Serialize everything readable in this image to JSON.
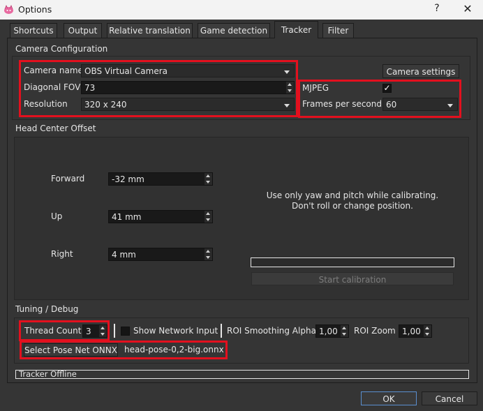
{
  "window": {
    "title": "Options",
    "help_glyph": "?",
    "close_glyph": "✕"
  },
  "tabs": [
    {
      "label": "Shortcuts"
    },
    {
      "label": "Output"
    },
    {
      "label": "Relative translation"
    },
    {
      "label": "Game detection"
    },
    {
      "label": "Tracker",
      "active": true
    },
    {
      "label": "Filter"
    }
  ],
  "camera_config": {
    "title": "Camera Configuration",
    "camera_name_label": "Camera name",
    "camera_name_value": "OBS Virtual Camera",
    "camera_settings_button": "Camera settings",
    "diagonal_fov_label": "Diagonal FOV",
    "diagonal_fov_value": "73",
    "mjpeg_label": "MJPEG",
    "mjpeg_checked": true,
    "resolution_label": "Resolution",
    "resolution_value": "320 x 240",
    "fps_label": "Frames per second",
    "fps_value": "60"
  },
  "head_center": {
    "title": "Head Center Offset",
    "forward_label": "Forward",
    "forward_value": "-32 mm",
    "up_label": "Up",
    "up_value": "41 mm",
    "right_label": "Right",
    "right_value": "4 mm",
    "instructions_line1": "Use only yaw and pitch while calibrating.",
    "instructions_line2": "Don't roll or change position.",
    "calibration_progress": 0,
    "start_calibration_button": "Start calibration"
  },
  "tuning": {
    "title": "Tuning / Debug",
    "thread_count_label": "Thread Count",
    "thread_count_value": "3",
    "show_network_input_label": "Show Network Input",
    "show_network_input_checked": false,
    "roi_smoothing_label": "ROI Smoothing Alpha",
    "roi_smoothing_value": "1,00",
    "roi_zoom_label": "ROI Zoom",
    "roi_zoom_value": "1,00",
    "select_pose_net_button": "Select Pose Net ONNX",
    "pose_net_file": "head-pose-0,2-big.onnx"
  },
  "status": {
    "text": "Tracker Offline"
  },
  "footer": {
    "ok_button": "OK",
    "cancel_button": "Cancel"
  },
  "colors": {
    "highlight_border": "#e3101e",
    "background": "#353535"
  }
}
